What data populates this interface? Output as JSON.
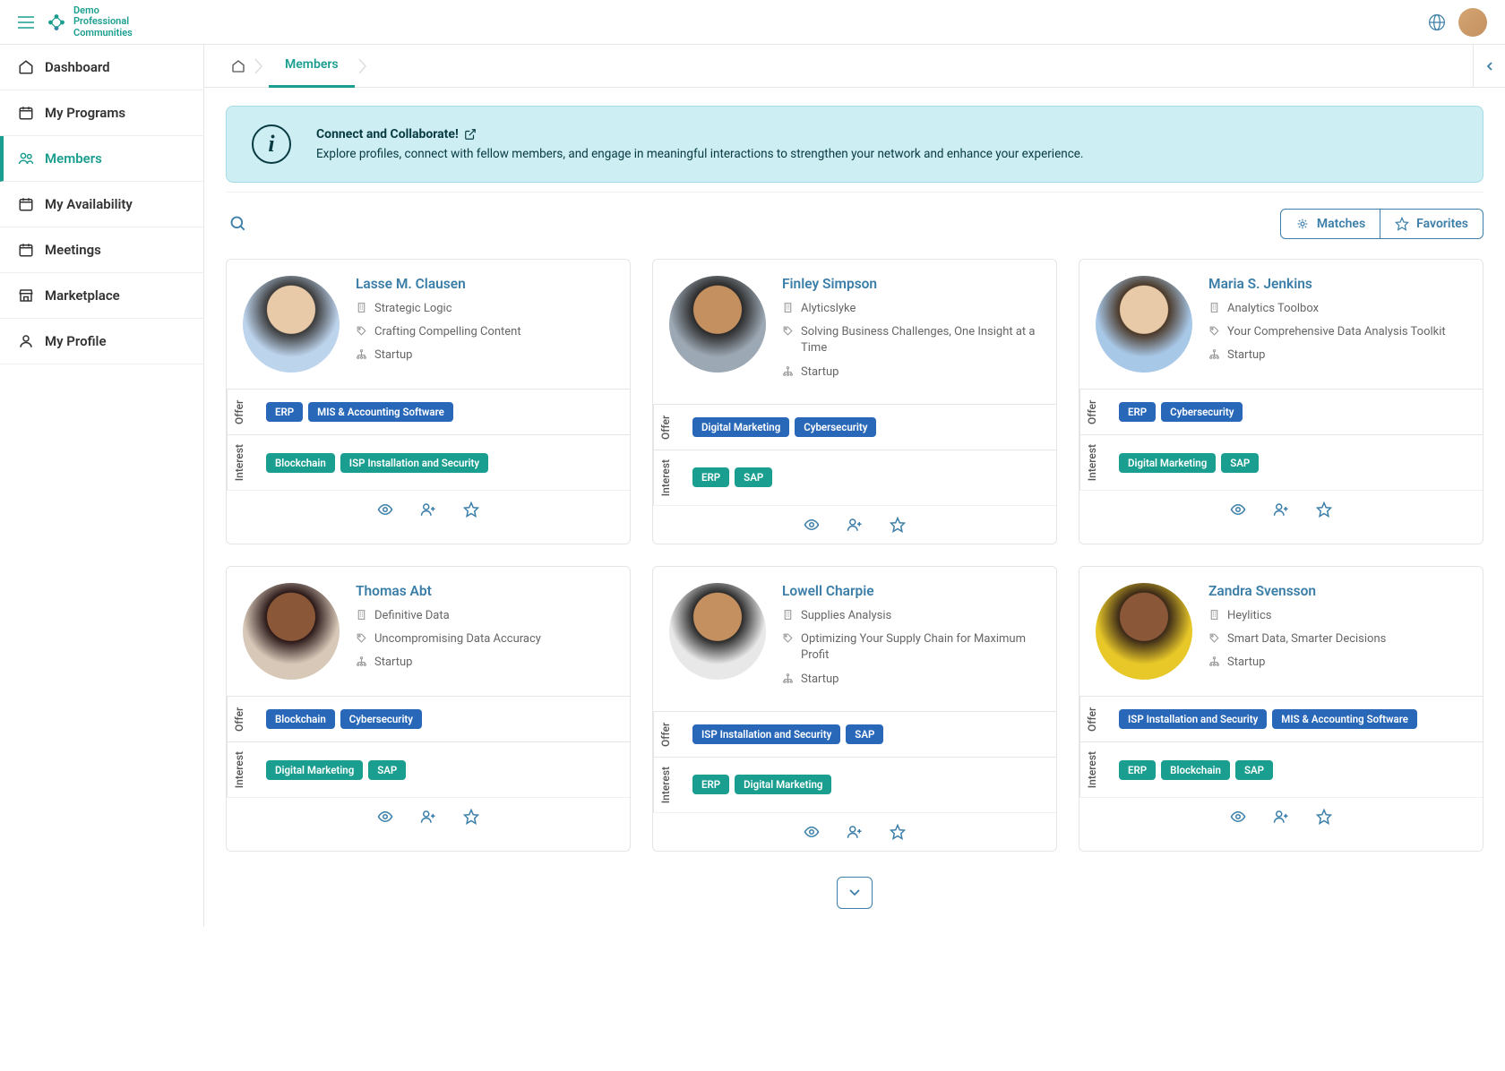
{
  "logo_text": "Demo\nProfessional\nCommunities",
  "sidebar": [
    {
      "icon": "home",
      "label": "Dashboard"
    },
    {
      "icon": "calendar",
      "label": "My Programs"
    },
    {
      "icon": "users",
      "label": "Members",
      "active": true
    },
    {
      "icon": "calendar",
      "label": "My Availability"
    },
    {
      "icon": "calendar",
      "label": "Meetings"
    },
    {
      "icon": "store",
      "label": "Marketplace"
    },
    {
      "icon": "user",
      "label": "My Profile"
    }
  ],
  "breadcrumb_current": "Members",
  "banner": {
    "title": "Connect and Collaborate!",
    "desc": "Explore profiles, connect with fellow members, and engage in meaningful interactions to strengthen your network and enhance your experience."
  },
  "toolbar": {
    "matches_label": "Matches",
    "favorites_label": "Favorites"
  },
  "offer_label": "Offer",
  "interest_label": "Interest",
  "members": [
    {
      "name": "Lasse M. Clausen",
      "company": "Strategic Logic",
      "tagline": "Crafting Compelling Content",
      "type": "Startup",
      "avatar": "av1",
      "offer": [
        "ERP",
        "MIS & Accounting Software"
      ],
      "interest": [
        "Blockchain",
        "ISP Installation and Security"
      ]
    },
    {
      "name": "Finley Simpson",
      "company": "Alyticslyke",
      "tagline": "Solving Business Challenges, One Insight at a Time",
      "type": "Startup",
      "avatar": "av2",
      "offer": [
        "Digital Marketing",
        "Cybersecurity"
      ],
      "interest": [
        "ERP",
        "SAP"
      ]
    },
    {
      "name": "Maria S. Jenkins",
      "company": "Analytics Toolbox",
      "tagline": "Your Comprehensive Data Analysis Toolkit",
      "type": "Startup",
      "avatar": "av3",
      "offer": [
        "ERP",
        "Cybersecurity"
      ],
      "interest": [
        "Digital Marketing",
        "SAP"
      ]
    },
    {
      "name": "Thomas Abt",
      "company": "Definitive Data",
      "tagline": "Uncompromising Data Accuracy",
      "type": "Startup",
      "avatar": "av4",
      "offer": [
        "Blockchain",
        "Cybersecurity"
      ],
      "interest": [
        "Digital Marketing",
        "SAP"
      ]
    },
    {
      "name": "Lowell Charpie",
      "company": "Supplies Analysis",
      "tagline": "Optimizing Your Supply Chain for Maximum Profit",
      "type": "Startup",
      "avatar": "av5",
      "offer": [
        "ISP Installation and Security",
        "SAP"
      ],
      "interest": [
        "ERP",
        "Digital Marketing"
      ]
    },
    {
      "name": "Zandra Svensson",
      "company": "Heylitics",
      "tagline": "Smart Data, Smarter Decisions",
      "type": "Startup",
      "avatar": "av6",
      "offer": [
        "ISP Installation and Security",
        "MIS & Accounting Software"
      ],
      "interest": [
        "ERP",
        "Blockchain",
        "SAP"
      ]
    }
  ]
}
